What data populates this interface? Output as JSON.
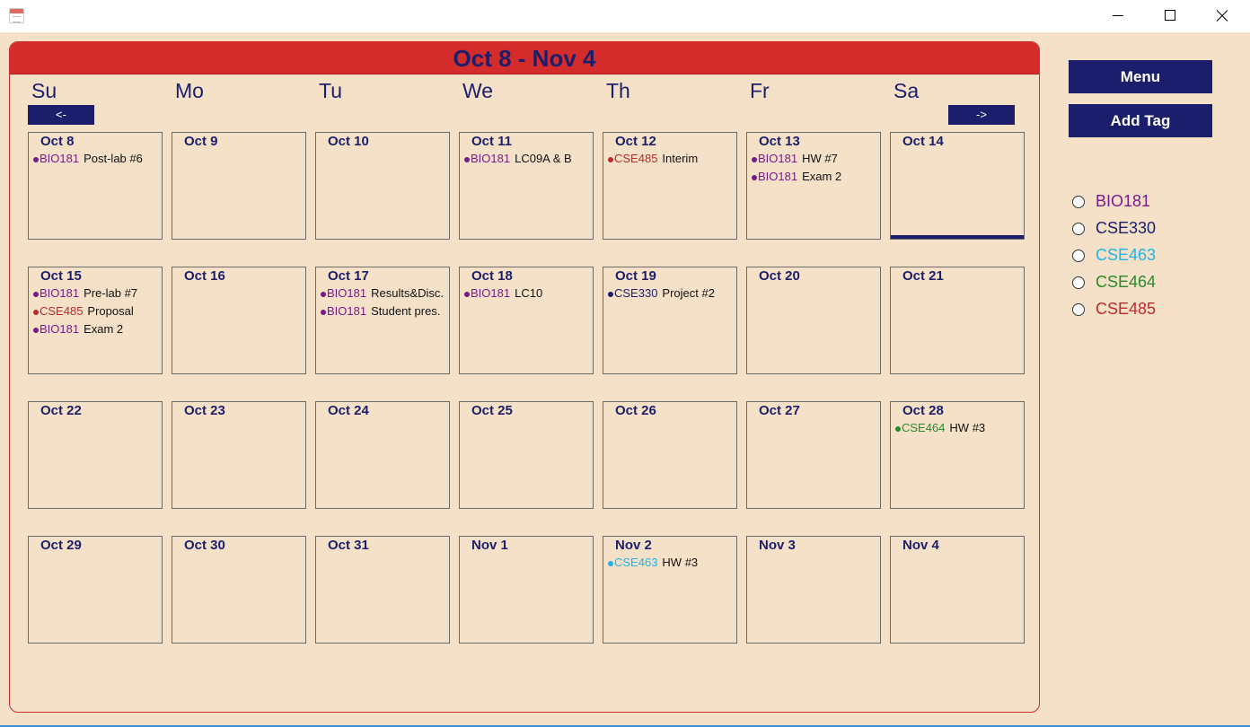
{
  "window": {
    "icon": "calendar-app-icon",
    "controls": [
      "minimize-icon",
      "maximize-icon",
      "close-icon"
    ]
  },
  "calendar": {
    "title": "Oct 8 - Nov 4",
    "weekdays": [
      "Su",
      "Mo",
      "Tu",
      "We",
      "Th",
      "Fr",
      "Sa"
    ],
    "prev_label": "<-",
    "next_label": "->",
    "today": "Oct 14",
    "weeks": [
      [
        {
          "label": "Oct 8",
          "events": [
            {
              "tag": "BIO181",
              "title": "Post-lab #6"
            }
          ]
        },
        {
          "label": "Oct 9",
          "events": []
        },
        {
          "label": "Oct 10",
          "events": []
        },
        {
          "label": "Oct 11",
          "events": [
            {
              "tag": "BIO181",
              "title": "LC09A & B"
            }
          ]
        },
        {
          "label": "Oct 12",
          "events": [
            {
              "tag": "CSE485",
              "title": "Interim"
            }
          ]
        },
        {
          "label": "Oct 13",
          "events": [
            {
              "tag": "BIO181",
              "title": "HW #7"
            },
            {
              "tag": "BIO181",
              "title": "Exam 2"
            }
          ]
        },
        {
          "label": "Oct 14",
          "events": []
        }
      ],
      [
        {
          "label": "Oct 15",
          "events": [
            {
              "tag": "BIO181",
              "title": "Pre-lab #7"
            },
            {
              "tag": "CSE485",
              "title": "Proposal"
            },
            {
              "tag": "BIO181",
              "title": "Exam 2"
            }
          ]
        },
        {
          "label": "Oct 16",
          "events": []
        },
        {
          "label": "Oct 17",
          "events": [
            {
              "tag": "BIO181",
              "title": "Results&Disc."
            },
            {
              "tag": "BIO181",
              "title": "Student pres."
            }
          ]
        },
        {
          "label": "Oct 18",
          "events": [
            {
              "tag": "BIO181",
              "title": "LC10"
            }
          ]
        },
        {
          "label": "Oct 19",
          "events": [
            {
              "tag": "CSE330",
              "title": "Project #2"
            }
          ]
        },
        {
          "label": "Oct 20",
          "events": []
        },
        {
          "label": "Oct 21",
          "events": []
        }
      ],
      [
        {
          "label": "Oct 22",
          "events": []
        },
        {
          "label": "Oct 23",
          "events": []
        },
        {
          "label": "Oct 24",
          "events": []
        },
        {
          "label": "Oct 25",
          "events": []
        },
        {
          "label": "Oct 26",
          "events": []
        },
        {
          "label": "Oct 27",
          "events": []
        },
        {
          "label": "Oct 28",
          "events": [
            {
              "tag": "CSE464",
              "title": "HW #3"
            }
          ]
        }
      ],
      [
        {
          "label": "Oct 29",
          "events": []
        },
        {
          "label": "Oct 30",
          "events": []
        },
        {
          "label": "Oct 31",
          "events": []
        },
        {
          "label": "Nov 1",
          "events": []
        },
        {
          "label": "Nov 2",
          "events": [
            {
              "tag": "CSE463",
              "title": "HW #3"
            }
          ]
        },
        {
          "label": "Nov 3",
          "events": []
        },
        {
          "label": "Nov 4",
          "events": []
        }
      ]
    ]
  },
  "sidebar": {
    "menu_label": "Menu",
    "add_tag_label": "Add Tag",
    "tags": [
      {
        "name": "BIO181",
        "color": "#7a1a8a"
      },
      {
        "name": "CSE330",
        "color": "#1b1f6b"
      },
      {
        "name": "CSE463",
        "color": "#1eb4e6"
      },
      {
        "name": "CSE464",
        "color": "#2a8a2a"
      },
      {
        "name": "CSE485",
        "color": "#c0282c"
      }
    ]
  },
  "colors": {
    "background": "#f5e1c8",
    "header_red": "#d42b2b",
    "navy": "#1b1f6b"
  }
}
